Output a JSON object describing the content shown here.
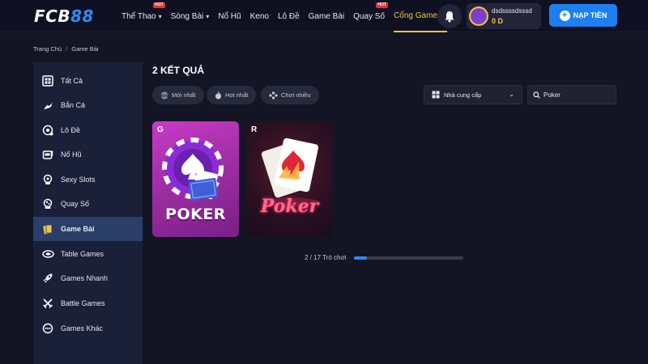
{
  "header": {
    "logo_part1": "FCB",
    "logo_part2": "88",
    "nav": [
      {
        "label": "Thể Thao",
        "hot": "HOT",
        "has_chevron": true
      },
      {
        "label": "Sòng Bài",
        "hot": "",
        "has_chevron": true
      },
      {
        "label": "Nổ Hũ",
        "hot": "",
        "has_chevron": false
      },
      {
        "label": "Keno",
        "hot": "",
        "has_chevron": false
      },
      {
        "label": "Lô Đề",
        "hot": "",
        "has_chevron": false
      },
      {
        "label": "Game Bài",
        "hot": "",
        "has_chevron": false
      },
      {
        "label": "Quay Số",
        "hot": "HOT",
        "has_chevron": false
      },
      {
        "label": "Cổng Games",
        "hot": "",
        "has_chevron": true,
        "active": true
      }
    ],
    "username": "dsdssssdsssd",
    "balance": "0 D",
    "deposit_label": "NẠP TIỀN"
  },
  "breadcrumb": {
    "home": "Trang Chủ",
    "separator": "/",
    "current": "Game Bài"
  },
  "sidebar": {
    "items": [
      {
        "label": "Tất Cả",
        "icon": "grid-icon"
      },
      {
        "label": "Bắn Cá",
        "icon": "fish-icon"
      },
      {
        "label": "Lô Đề",
        "icon": "lottery-ball-icon"
      },
      {
        "label": "Nổ Hũ",
        "icon": "slot-machine-icon"
      },
      {
        "label": "Sexy Slots",
        "icon": "slots-icon"
      },
      {
        "label": "Quay Số",
        "icon": "lottery-draw-icon"
      },
      {
        "label": "Game Bài",
        "icon": "cards-icon",
        "active": true
      },
      {
        "label": "Table Games",
        "icon": "table-icon"
      },
      {
        "label": "Games Nhanh",
        "icon": "rocket-icon"
      },
      {
        "label": "Battle Games",
        "icon": "swords-icon"
      },
      {
        "label": "Games Khác",
        "icon": "more-games-icon"
      }
    ]
  },
  "main": {
    "result_title": "2 KẾT QUẢ",
    "filters": [
      {
        "label": "Mới nhất",
        "icon": "new-icon"
      },
      {
        "label": "Hot nhất",
        "icon": "fire-icon"
      },
      {
        "label": "Chơi nhiều",
        "icon": "gamepad-icon"
      }
    ],
    "provider_label": "Nhà cung cấp",
    "search_value": "Poker",
    "games": [
      {
        "badge": "G",
        "title": "POKER"
      },
      {
        "badge": "R",
        "title": "Poker"
      }
    ],
    "pagination_text": "2 / 17 Trò chơi",
    "progress_fraction": 0.118
  },
  "colors": {
    "accent_blue": "#2d8cf0",
    "accent_gold": "#f6c244",
    "hot_red": "#e5322d",
    "bg": "#131525"
  }
}
